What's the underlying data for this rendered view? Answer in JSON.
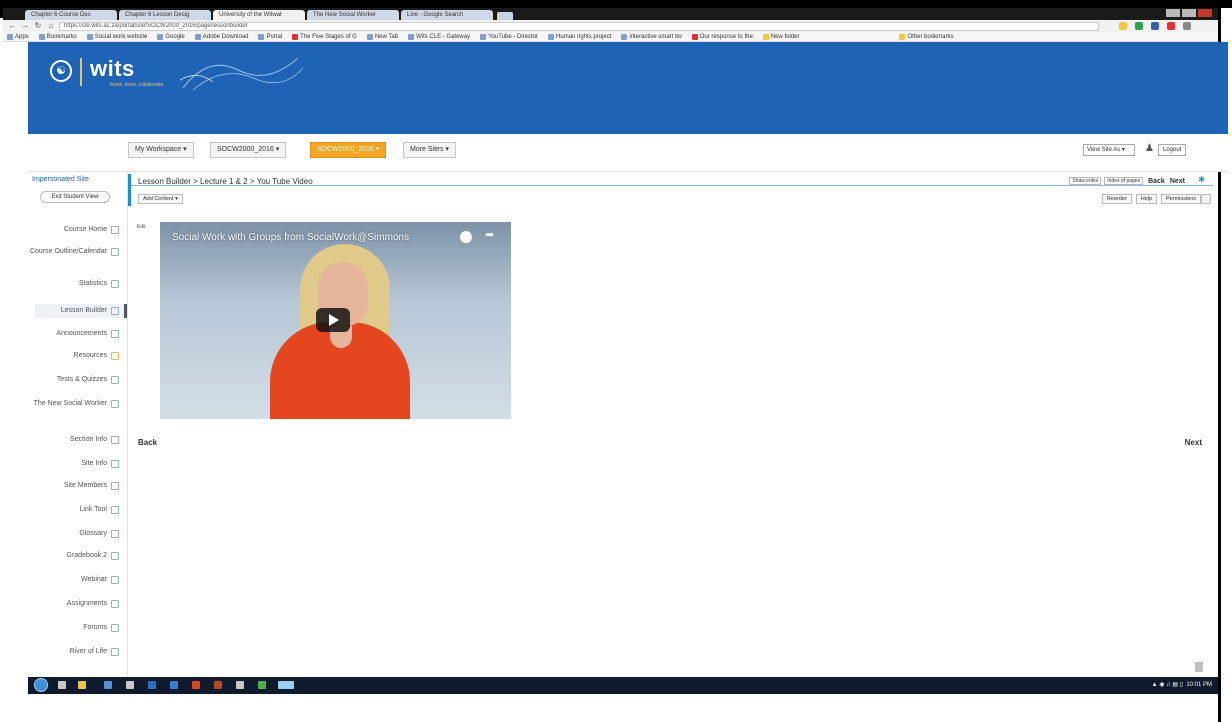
{
  "browser": {
    "tabs": [
      {
        "label": "Chapter 6 Course Des",
        "active": false
      },
      {
        "label": "Chapter 6 Lesson Desig",
        "active": false
      },
      {
        "label": "University of the Witwat",
        "active": true
      },
      {
        "label": "The New Social Worker",
        "active": false
      },
      {
        "label": "Live - Google Search",
        "active": false
      }
    ],
    "url": "https://cle.wits.ac.za/portal/site/SOCW2000_2016/page/lessonbuilder",
    "bookmarks": [
      "Apps",
      "Bookmarks",
      "Social work website",
      "Google",
      "Adobe Download",
      "Portal",
      "The Five Stages of G",
      "New Tab",
      "Wits CLE - Gateway",
      "YouTube - Director",
      "Human rights project",
      "interactive smart bo",
      "Our response to the",
      "New folder",
      "Other bookmarks"
    ]
  },
  "header": {
    "logo_text": "wits",
    "logo_tag": "teach. learn. collaborate"
  },
  "site_nav": {
    "workspace": "My Workspace",
    "site_1": "SOCW2000_2016",
    "site_2": "SOCW2000_2016",
    "more_sites": "More Sites",
    "view_site_as": "View Site As",
    "logout": "Logout"
  },
  "sidebar": {
    "title": "Impersonated Site",
    "exit": "Exit Student View",
    "items": [
      {
        "label": "Course Home"
      },
      {
        "label": "Course Outline/Calendar"
      },
      {
        "label": "Statistics"
      },
      {
        "label": "Lesson Builder"
      },
      {
        "label": "Announcements"
      },
      {
        "label": "Resources"
      },
      {
        "label": "Tests & Quizzes"
      },
      {
        "label": "The New Social Worker"
      },
      {
        "label": "Section Info"
      },
      {
        "label": "Site Info"
      },
      {
        "label": "Site Members"
      },
      {
        "label": "Link Tool"
      },
      {
        "label": "Glossary"
      },
      {
        "label": "Gradebook 2"
      },
      {
        "label": "Webinar"
      },
      {
        "label": "Assignments"
      },
      {
        "label": "Forums"
      },
      {
        "label": "River of Life"
      }
    ]
  },
  "main": {
    "breadcrumb": "Lesson Builder > Lecture 1 & 2 > You Tube Video",
    "add_content": "Add Content",
    "show_index": "Show index",
    "index_pages": "Index of pages",
    "back_top": "Back",
    "next_top": "Next",
    "reorder": "Reorder",
    "help": "Help",
    "permissions": "Permissions",
    "edit_label": "Edit",
    "video_title": "Social Work with Groups from SocialWork@Simmons",
    "back_bottom": "Back",
    "next_bottom": "Next"
  },
  "taskbar": {
    "clock": "10:01 PM"
  }
}
